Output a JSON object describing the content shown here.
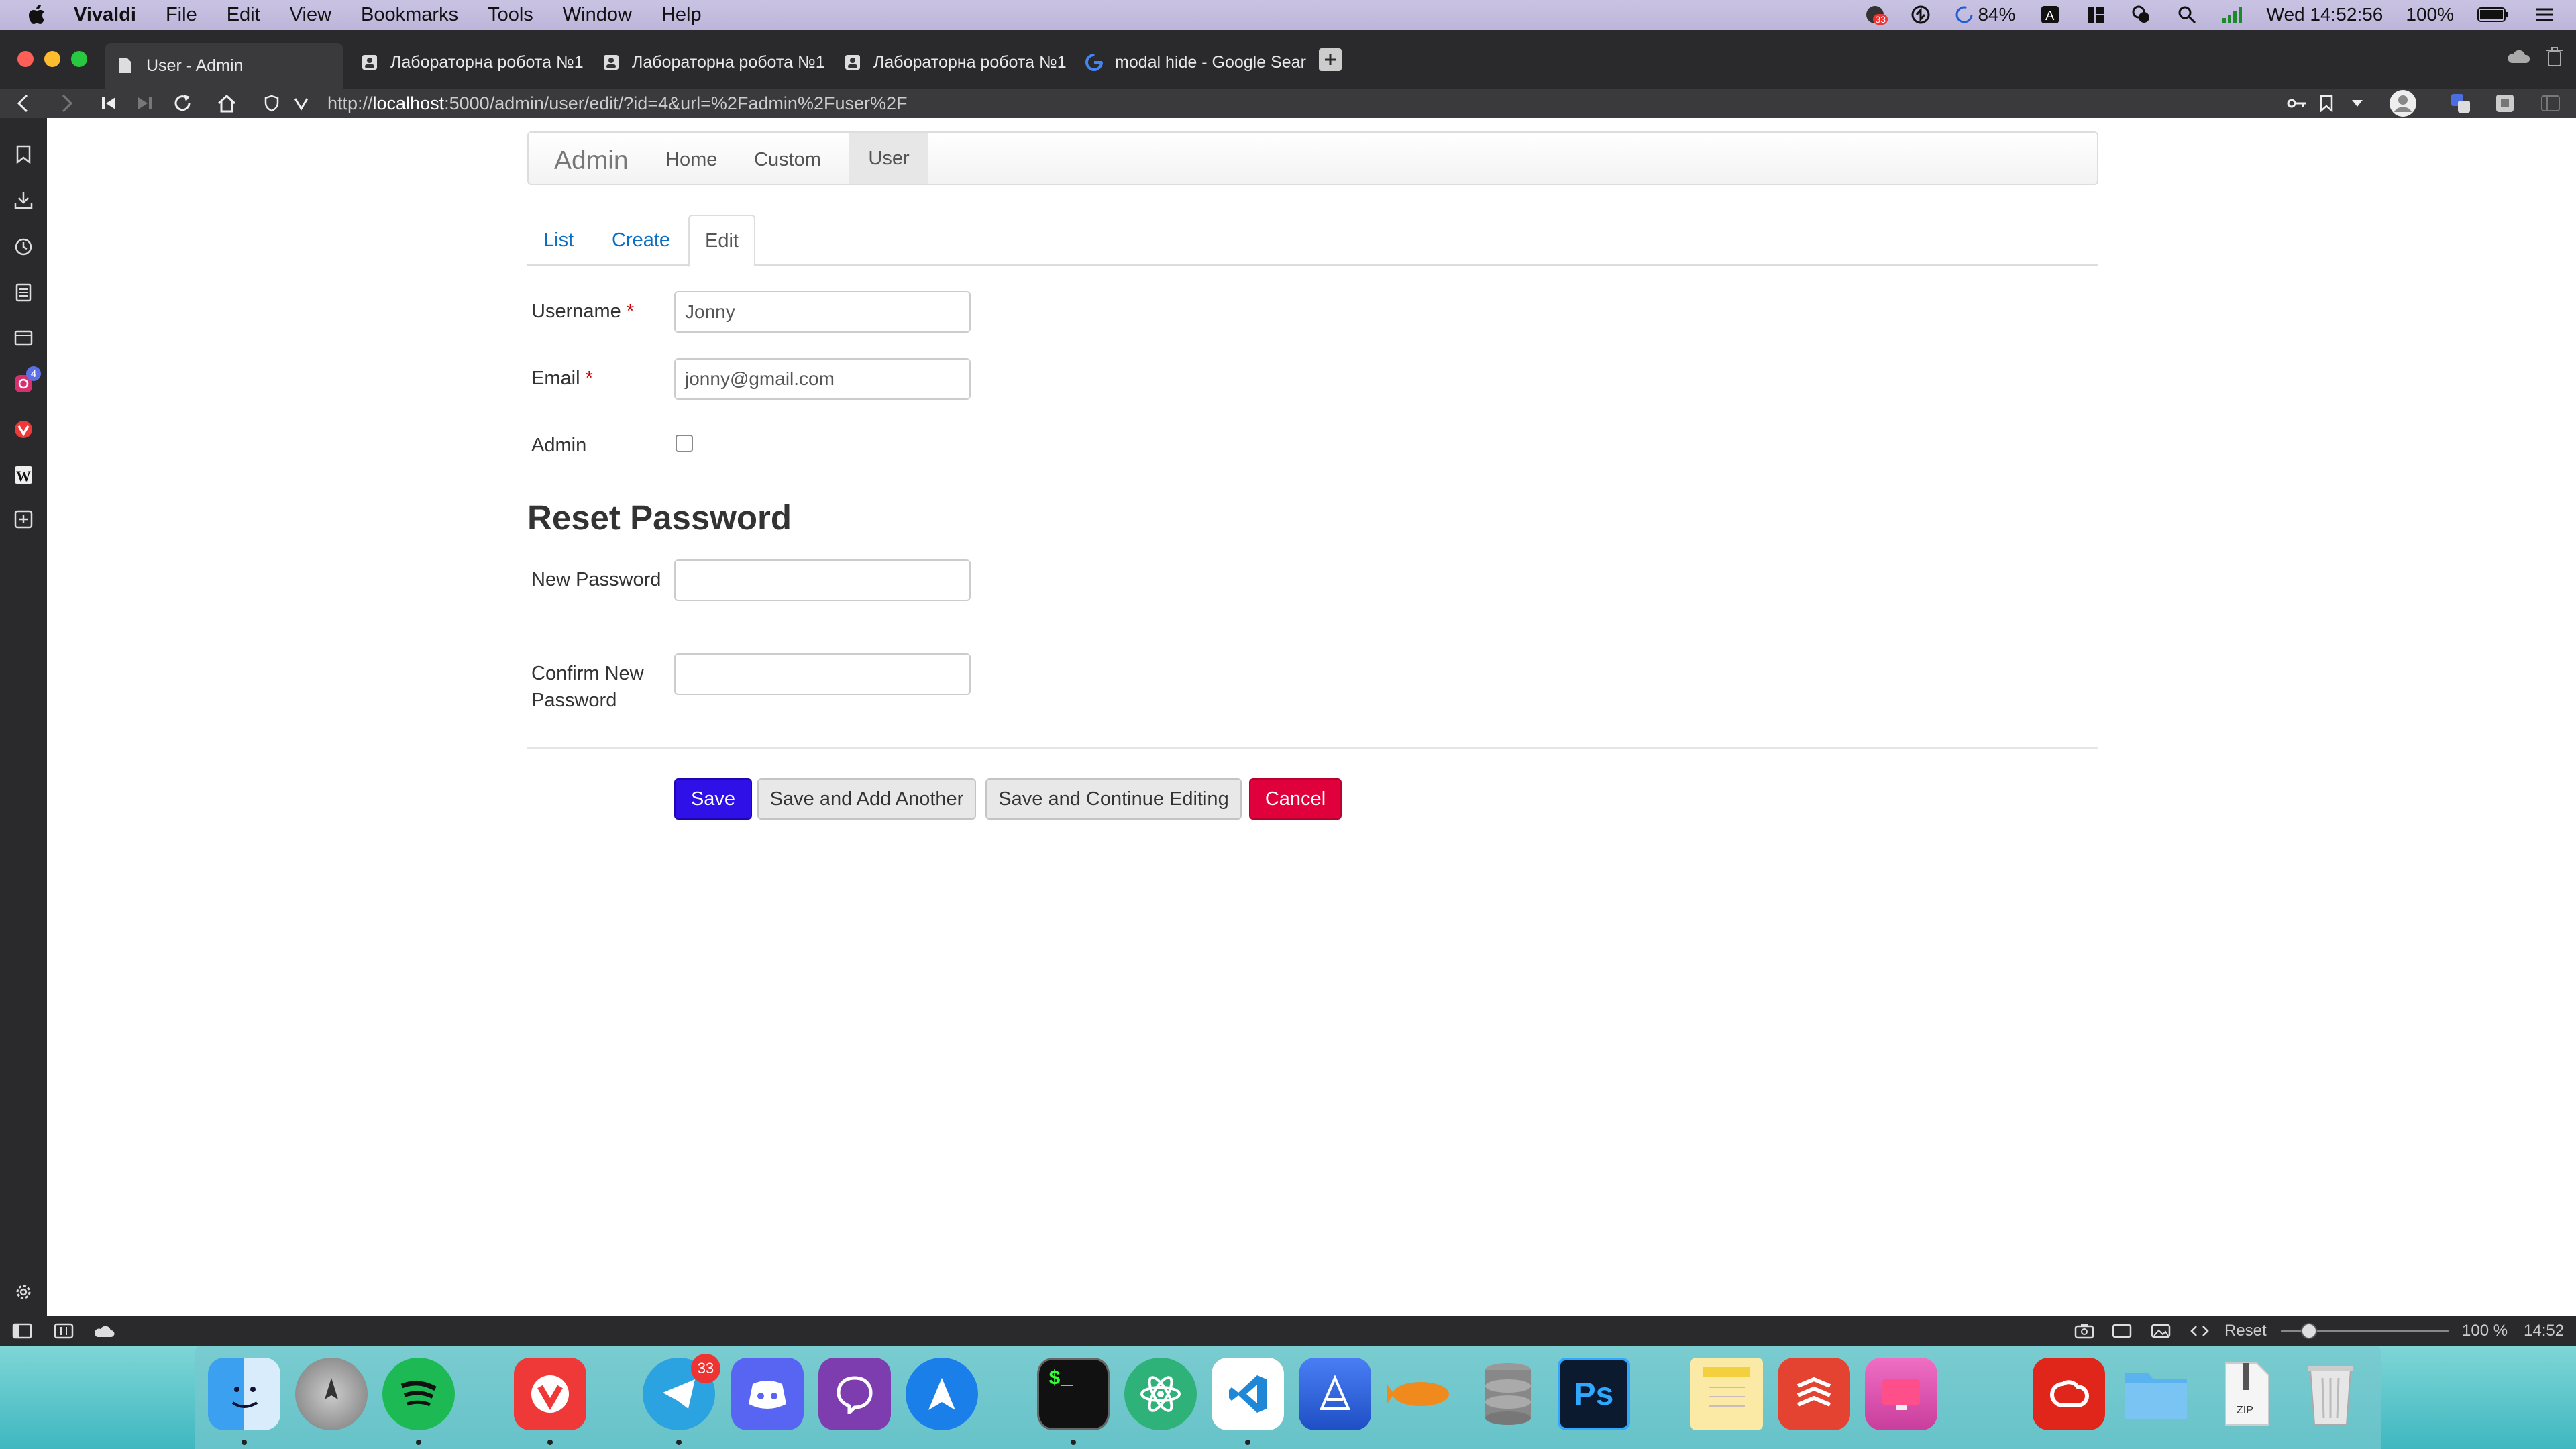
{
  "menubar": {
    "app_name": "Vivaldi",
    "items": [
      "File",
      "Edit",
      "View",
      "Bookmarks",
      "Tools",
      "Window",
      "Help"
    ],
    "battery_small": "84%",
    "clock": "Wed 14:52:56",
    "battery": "100%",
    "notification_count": "33"
  },
  "tabs": [
    {
      "title": "User - Admin"
    },
    {
      "title": "Лабораторна робота №1"
    },
    {
      "title": "Лабораторна робота №1"
    },
    {
      "title": "Лабораторна робота №1"
    },
    {
      "title": "modal hide - Google Sear"
    }
  ],
  "address": {
    "prefix": "http://",
    "host": "localhost",
    "path": ":5000/admin/user/edit/?id=4&url=%2Fadmin%2Fuser%2F"
  },
  "sidepanel": {
    "instagram_badge": "4"
  },
  "navbar": {
    "brand": "Admin",
    "links": [
      "Home",
      "Custom",
      "User"
    ]
  },
  "subtabs": [
    "List",
    "Create",
    "Edit"
  ],
  "form": {
    "username_label": "Username",
    "username_value": "Jonny",
    "email_label": "Email",
    "email_value": "jonny@gmail.com",
    "required_mark": "*",
    "admin_label": "Admin",
    "admin_checked": false,
    "reset_heading": "Reset Password",
    "new_password_label": "New Password",
    "new_password_value": "",
    "confirm_label_line1": "Confirm New",
    "confirm_label_line2": "Password",
    "confirm_value": ""
  },
  "buttons": {
    "save": "Save",
    "save_add": "Save and Add Another",
    "save_continue": "Save and Continue Editing",
    "cancel": "Cancel"
  },
  "statusbar": {
    "reset": "Reset",
    "zoom": "100 %",
    "time": "14:52"
  },
  "dock": {
    "telegram_badge": "33",
    "terminal_text": "$_",
    "photoshop_text": "Ps",
    "zip_text": "ZIP"
  },
  "colors": {
    "save_button": "#2f10e6",
    "cancel_button": "#e0003c",
    "link": "#0a6ec2",
    "required": "#cc0000"
  }
}
